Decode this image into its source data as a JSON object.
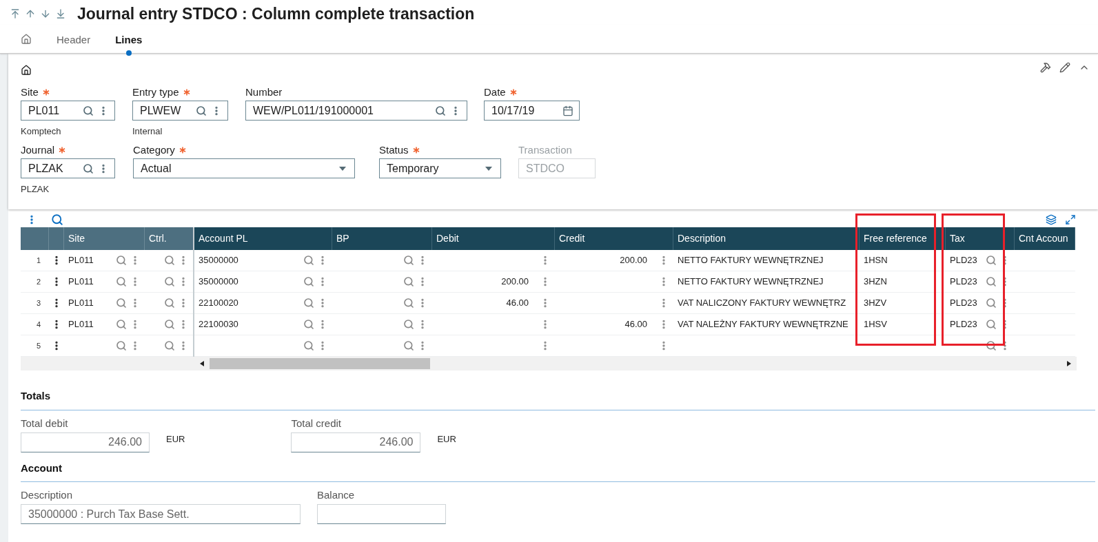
{
  "title": "Journal entry STDCO : Column complete transaction",
  "tabs": [
    {
      "label": "Header",
      "selected": false
    },
    {
      "label": "Lines",
      "selected": true
    }
  ],
  "form": {
    "rows": [
      [
        {
          "label": "Site",
          "required": true,
          "kind": "lookup",
          "value": "PL011",
          "note": "Komptech",
          "disabled": false
        },
        {
          "label": "Entry type",
          "required": true,
          "kind": "lookup",
          "value": "PLWEW",
          "note": "Internal",
          "disabled": false
        },
        {
          "label": "Number",
          "required": false,
          "kind": "lookup",
          "value": "WEW/PL011/191000001",
          "disabled": false
        },
        {
          "label": "Date",
          "required": true,
          "kind": "date",
          "value": "10/17/19",
          "disabled": false
        }
      ],
      [
        {
          "label": "Journal",
          "required": true,
          "kind": "lookup",
          "value": "PLZAK",
          "note": "PLZAK",
          "disabled": false
        },
        {
          "label": "Category",
          "required": true,
          "kind": "select",
          "value": "Actual",
          "disabled": false
        },
        {
          "label": "Status",
          "required": true,
          "kind": "select",
          "value": "Temporary",
          "disabled": false
        },
        {
          "label": "Transaction",
          "required": false,
          "kind": "text",
          "value": "STDCO",
          "disabled": true
        }
      ]
    ]
  },
  "table": {
    "columns": [
      {
        "label": "Site",
        "kind": "lookup",
        "frozen": true,
        "highlighted": false
      },
      {
        "label": "Ctrl.",
        "kind": "lookup",
        "frozen": true,
        "highlighted": false
      },
      {
        "label": "Account PL",
        "kind": "lookup",
        "frozen": false,
        "highlighted": false
      },
      {
        "label": "BP",
        "kind": "lookup",
        "frozen": false,
        "highlighted": false
      },
      {
        "label": "Debit",
        "kind": "amount",
        "frozen": false,
        "highlighted": false
      },
      {
        "label": "Credit",
        "kind": "amount",
        "frozen": false,
        "highlighted": false
      },
      {
        "label": "Description",
        "kind": "text",
        "frozen": false,
        "highlighted": false
      },
      {
        "label": "Free reference",
        "kind": "text",
        "frozen": false,
        "highlighted": true
      },
      {
        "label": "Tax",
        "kind": "lookup",
        "frozen": false,
        "highlighted": true
      },
      {
        "label": "Cnt Accoun",
        "kind": "text",
        "frozen": false,
        "highlighted": false
      }
    ],
    "rows": [
      {
        "number": "1",
        "cells": [
          "PL011",
          "",
          "35000000",
          "",
          "",
          "200.00",
          "NETTO FAKTURY WEWNĘTRZNEJ",
          "1HSN",
          "PLD23",
          ""
        ]
      },
      {
        "number": "2",
        "cells": [
          "PL011",
          "",
          "35000000",
          "",
          "200.00",
          "",
          "NETTO FAKTURY WEWNĘTRZNEJ",
          "3HZN",
          "PLD23",
          ""
        ]
      },
      {
        "number": "3",
        "cells": [
          "PL011",
          "",
          "22100020",
          "",
          "46.00",
          "",
          "VAT NALICZONY FAKTURY WEWNĘTRZ",
          "3HZV",
          "PLD23",
          ""
        ]
      },
      {
        "number": "4",
        "cells": [
          "PL011",
          "",
          "22100030",
          "",
          "",
          "46.00",
          "VAT NALEŻNY FAKTURY WEWNĘTRZNE",
          "1HSV",
          "PLD23",
          ""
        ]
      },
      {
        "number": "5",
        "cells": [
          "",
          "",
          "",
          "",
          "",
          "",
          "",
          "",
          "",
          ""
        ]
      }
    ]
  },
  "sections": [
    {
      "title": "Totals",
      "fields": [
        {
          "label": "Total debit",
          "value": "246.00",
          "unit": "EUR"
        },
        {
          "label": "Total credit",
          "value": "246.00",
          "unit": "EUR"
        }
      ]
    },
    {
      "title": "Account",
      "fields": [
        {
          "label": "Description",
          "value": "35000000 : Purch Tax Base Sett."
        },
        {
          "label": "Balance"
        }
      ]
    }
  ]
}
